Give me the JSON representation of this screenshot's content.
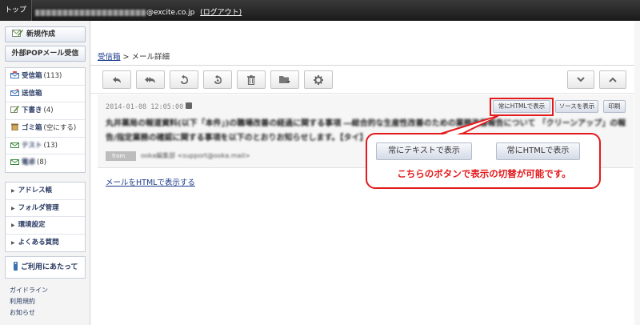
{
  "topbar": {
    "home_label": "トップ",
    "account_domain": "@excite.co.jp",
    "logout_label": "(ログアウト)"
  },
  "sidebar": {
    "compose_label": "新規作成",
    "pop_label": "外部POPメール受信",
    "folders": [
      {
        "label": "受信箱",
        "count": "(113)",
        "icon": "inbox-icon"
      },
      {
        "label": "送信箱",
        "count": "",
        "icon": "sent-icon"
      },
      {
        "label": "下書き",
        "count": "(4)",
        "icon": "draft-icon"
      },
      {
        "label": "ゴミ箱",
        "count": "(空にする)",
        "icon": "trash-icon"
      },
      {
        "label": "テスト",
        "count": "(13)",
        "icon": "folder-icon"
      },
      {
        "label": "電卓",
        "count": "(8)",
        "icon": "folder-icon"
      }
    ],
    "menu": [
      {
        "label": "アドレス帳"
      },
      {
        "label": "フォルダ管理"
      },
      {
        "label": "環境設定"
      },
      {
        "label": "よくある質問"
      }
    ],
    "info_heading": "ご利用にあたって",
    "info_links": [
      "ガイドライン",
      "利用規約",
      "お知らせ"
    ]
  },
  "breadcrumb": {
    "parent_label": "受信箱",
    "separator": " > ",
    "current_label": "メール詳細"
  },
  "toolbar": {
    "buttons": [
      "reply-icon",
      "reply-all-icon",
      "forward-icon",
      "forward-attach-icon",
      "delete-icon",
      "move-folder-icon",
      "settings-icon"
    ],
    "nav_buttons": [
      "chevron-down-icon",
      "chevron-up-icon"
    ]
  },
  "message": {
    "date": "2014-01-08 12:05:00",
    "subject": "丸井薬局の報道資料(以下「本件」)の職場改善の経過に関する事項 ―総合的な生産性改善のための業務改善報告について 「クリーンアップ」の報告/指定業務の確認に関する事項を以下のとおりお知らせします。【タイ】",
    "from_tag": "from",
    "from_name": "ooka編集部 <support@ooka.mail>",
    "view_buttons": {
      "always_html": "常にHTMLで表示",
      "source": "ソースを表示",
      "print": "印刷"
    },
    "html_link": "メールをHTMLで表示する"
  },
  "callout": {
    "text_button": "常にテキストで表示",
    "html_button": "常にHTMLで表示",
    "message": "こちらのボタンで表示の切替が可能です。"
  },
  "colors": {
    "accent_red": "#e3191b",
    "link_blue": "#1a3a8a",
    "topbar_dark": "#1a1a1a"
  }
}
